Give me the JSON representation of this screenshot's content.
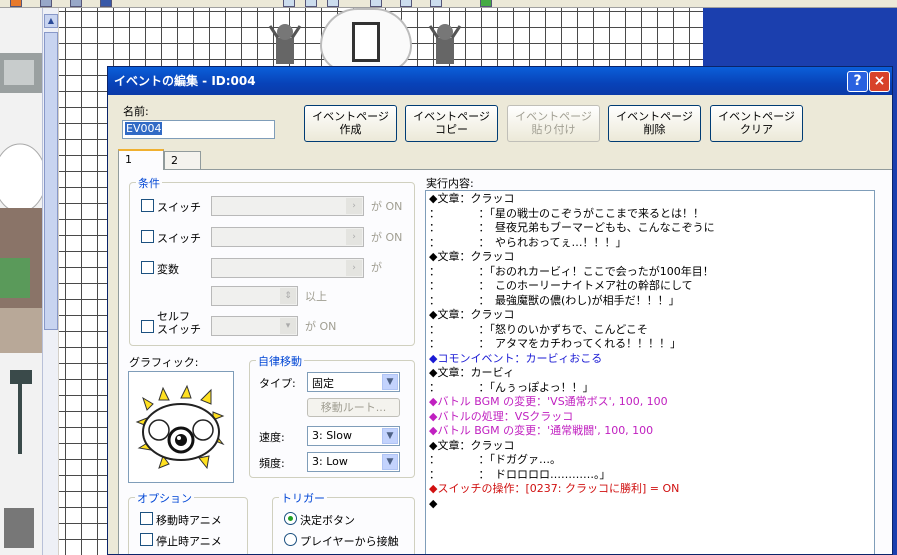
{
  "dialog": {
    "title": "イベントの編集 - ID:004",
    "help_label": "?",
    "close_label": "×",
    "name_label": "名前:",
    "name_value": "EV004",
    "page_buttons": [
      {
        "label": "イベントページ\n作成",
        "enabled": true
      },
      {
        "label": "イベントページ\nコピー",
        "enabled": true
      },
      {
        "label": "イベントページ\n貼り付け",
        "enabled": false
      },
      {
        "label": "イベントページ\n削除",
        "enabled": true
      },
      {
        "label": "イベントページ\nクリア",
        "enabled": true
      }
    ],
    "tabs": [
      "1",
      "2"
    ],
    "conditions": {
      "title": "条件",
      "switch1": "スイッチ",
      "switch1_suffix": "が ON",
      "switch2": "スイッチ",
      "switch2_suffix": "が ON",
      "variable": "変数",
      "variable_suffix": "が",
      "variable_ge": "以上",
      "self_switch": "セルフ\nスイッチ",
      "self_switch_suffix": "が ON"
    },
    "graphic_label": "グラフィック:",
    "autonomous": {
      "title": "自律移動",
      "type_label": "タイプ:",
      "type_value": "固定",
      "route_button": "移動ルート...",
      "speed_label": "速度:",
      "speed_value": "3: Slow",
      "freq_label": "頻度:",
      "freq_value": "3: Low"
    },
    "options": {
      "title": "オプション",
      "items": [
        "移動時アニメ",
        "停止時アニメ"
      ]
    },
    "trigger": {
      "title": "トリガー",
      "items": [
        "決定ボタン",
        "プレイヤーから接触"
      ],
      "selected": "決定ボタン"
    },
    "exec_label": "実行内容:",
    "commands": [
      {
        "text": "◆文章：クラッコ",
        "color": "#000000"
      },
      {
        "text": "：　　　　：「星の戦士のこぞうがここまで来るとは！！",
        "color": "#000000"
      },
      {
        "text": "：　　　　：　昼夜兄弟もブーマーどもも、こんなこぞうに",
        "color": "#000000"
      },
      {
        "text": "：　　　　：　やられおってぇ…！！！」",
        "color": "#000000"
      },
      {
        "text": "◆文章：クラッコ",
        "color": "#000000"
      },
      {
        "text": "：　　　　：「おのれカービィ！ここで会ったが100年目！",
        "color": "#000000"
      },
      {
        "text": "：　　　　：　このホーリーナイトメア社の幹部にして",
        "color": "#000000"
      },
      {
        "text": "：　　　　：　最強魔獣の儂(わし)が相手だ！！！」",
        "color": "#000000"
      },
      {
        "text": "◆文章：クラッコ",
        "color": "#000000"
      },
      {
        "text": "：　　　　：「怒りのいかずちで、こんどこそ",
        "color": "#000000"
      },
      {
        "text": "：　　　　：　アタマをカチわってくれる！！！！」",
        "color": "#000000"
      },
      {
        "text": "◆コモンイベント：カービィおこる",
        "color": "#1b1bd4"
      },
      {
        "text": "◆文章：カービィ",
        "color": "#000000"
      },
      {
        "text": "：　　　　：「んぅっぽよっ！！」",
        "color": "#000000"
      },
      {
        "text": "◆バトル BGM の変更：'VS通常ボス', 100, 100",
        "color": "#c020c0"
      },
      {
        "text": "◆バトルの処理：VSクラッコ",
        "color": "#c020c0"
      },
      {
        "text": "◆バトル BGM の変更：'通常戦闘', 100, 100",
        "color": "#c020c0"
      },
      {
        "text": "◆文章：クラッコ",
        "color": "#000000"
      },
      {
        "text": "：　　　　：「ドガグァ…。",
        "color": "#000000"
      },
      {
        "text": "：　　　　：　ドロロロロ…………。」",
        "color": "#000000"
      },
      {
        "text": "◆スイッチの操作：[0237: クラッコに勝利] = ON",
        "color": "#d01010"
      },
      {
        "text": "◆",
        "color": "#000000"
      }
    ]
  }
}
